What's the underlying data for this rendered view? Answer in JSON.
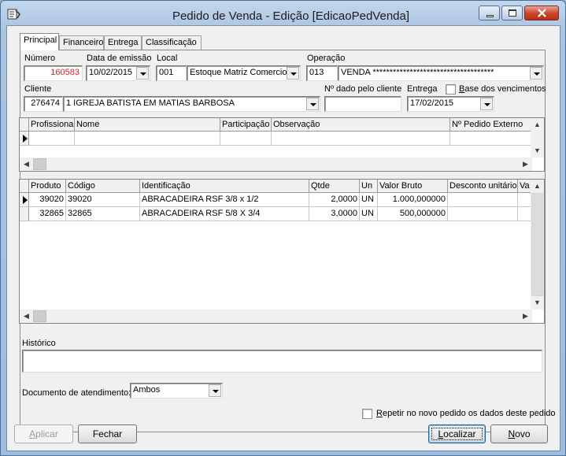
{
  "window": {
    "title": "Pedido de Venda - Edição [EdicaoPedVenda]"
  },
  "tabs": [
    "Principal",
    "Financeiro",
    "Entrega",
    "Classificação"
  ],
  "header": {
    "numero_label": "Número",
    "numero": "160583",
    "data_label": "Data de emissão",
    "data": "10/02/2015",
    "local_label": "Local",
    "local_code": "001",
    "local_name": "Estoque Matriz Comercio",
    "operacao_label": "Operação",
    "operacao_code": "013",
    "operacao_name": "VENDA ************************************",
    "cliente_label": "Cliente",
    "cliente_code": "276474",
    "cliente_name": "1 IGREJA BATISTA EM MATIAS BARBOSA",
    "pedido_cliente_label": "Nº dado pelo cliente",
    "pedido_cliente": "",
    "entrega_label": "Entrega",
    "entrega": "17/02/2015",
    "base_venc_pre": "",
    "base_venc_u": "B",
    "base_venc_rest": "ase dos vencimentos"
  },
  "prof_grid": {
    "columns": [
      "Profissional",
      "Nome",
      "Participação",
      "Observação",
      "Nº Pedido Externo"
    ]
  },
  "items_grid": {
    "columns": [
      "Produto",
      "Código",
      "Identificação",
      "Qtde",
      "Un",
      "Valor Bruto",
      "Desconto unitário",
      "Va"
    ],
    "rows": [
      [
        "39020",
        "39020",
        "ABRACADEIRA RSF 3/8 x 1/2",
        "2,0000",
        "UN",
        "1.000,000000",
        "",
        ""
      ],
      [
        "32865",
        "32865",
        "ABRACADEIRA RSF 5/8 X 3/4",
        "3,0000",
        "UN",
        "500,000000",
        "",
        ""
      ]
    ]
  },
  "historico": {
    "label": "Histórico",
    "value": ""
  },
  "documento": {
    "label": "Documento de atendimento:",
    "value": "Ambos"
  },
  "repetir": {
    "u": "R",
    "rest": "epetir no novo pedido os dados deste pedido"
  },
  "buttons": {
    "aplicar_u": "A",
    "aplicar_rest": "plicar",
    "fechar": "Fechar",
    "localizar_u": "L",
    "localizar_rest": "ocalizar",
    "novo_u": "N",
    "novo_rest": "ovo"
  },
  "colors": {
    "numero_text": "#e0202a",
    "title_bar": "#a9c3e1"
  }
}
